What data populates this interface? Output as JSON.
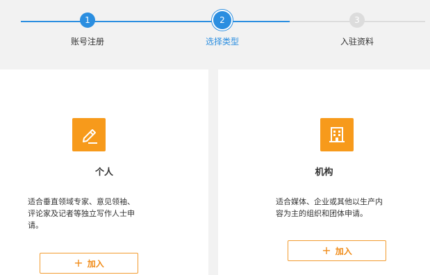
{
  "stepper": {
    "steps": [
      {
        "number": "1",
        "label": "账号注册",
        "state": "done"
      },
      {
        "number": "2",
        "label": "选择类型",
        "state": "current"
      },
      {
        "number": "3",
        "label": "入驻资料",
        "state": "todo"
      }
    ],
    "colors": {
      "active": "#2b8ee0",
      "inactive": "#dcdcdc"
    }
  },
  "cards": {
    "personal": {
      "icon": "pencil-sign-icon",
      "title": "个人",
      "desc_lines": [
        "适合垂直领域专家、意见领袖、",
        "评论家及记者等独立写作人士申",
        "请。"
      ],
      "button": {
        "plus": "+",
        "label": "加入"
      }
    },
    "org": {
      "icon": "building-icon",
      "title": "机构",
      "desc_lines": [
        "适合媒体、企业或其他以生产内",
        "容为主的组织和团体申请。"
      ],
      "button": {
        "plus": "+",
        "label": "加入"
      }
    }
  },
  "colors": {
    "accent": "#f79a1b",
    "button_text": "#f08a15"
  }
}
